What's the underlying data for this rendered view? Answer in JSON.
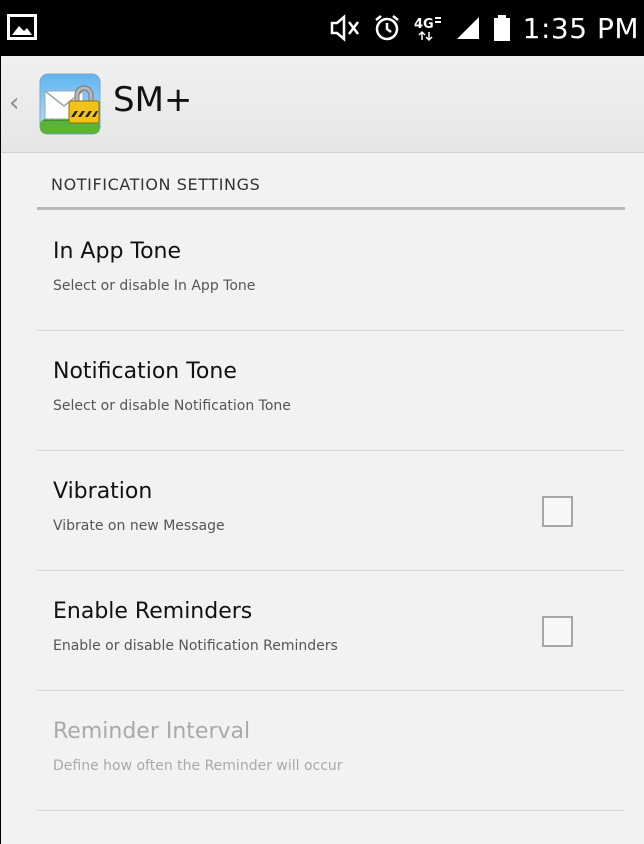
{
  "status_bar": {
    "time": "1:35 PM",
    "icons": [
      "image-notification-icon",
      "mute-icon",
      "alarm-icon",
      "4g-lte-icon",
      "signal-icon",
      "battery-icon"
    ]
  },
  "action_bar": {
    "title": "SM+",
    "back_icon": "chevron-left-icon",
    "logo_icon": "secure-mail-logo-icon"
  },
  "section": {
    "header": "NOTIFICATION SETTINGS"
  },
  "preferences": [
    {
      "title": "In App Tone",
      "summary": "Select or disable In App Tone",
      "checkbox": false,
      "enabled": true
    },
    {
      "title": "Notification Tone",
      "summary": "Select or disable Notification Tone",
      "checkbox": false,
      "enabled": true
    },
    {
      "title": "Vibration",
      "summary": "Vibrate on new Message",
      "checkbox": true,
      "checked": false,
      "enabled": true
    },
    {
      "title": "Enable Reminders",
      "summary": "Enable or disable Notification Reminders",
      "checkbox": true,
      "checked": false,
      "enabled": true
    },
    {
      "title": "Reminder Interval",
      "summary": "Define how often the Reminder will occur",
      "checkbox": false,
      "enabled": false
    }
  ],
  "colors": {
    "status_bar_bg": "#000000",
    "action_bar_bg": "#eeeeee",
    "content_bg": "#f2f2f2",
    "disabled_text": "#a9a9a9"
  }
}
